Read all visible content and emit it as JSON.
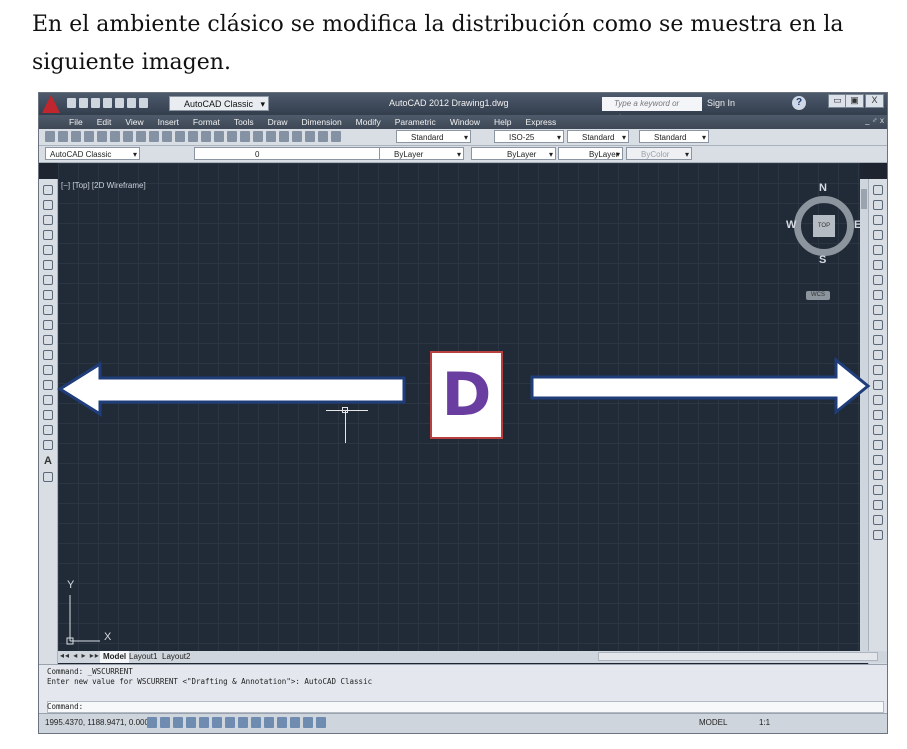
{
  "paragraph": {
    "line1": "En el ambiente clásico  se modifica la distribución como se muestra en la",
    "line2": "siguiente imagen."
  },
  "autocad": {
    "workspace_select": "AutoCAD Classic",
    "app_title": "AutoCAD 2012   Drawing1.dwg",
    "search_placeholder": "Type a keyword or phrase",
    "sign_in": "Sign In",
    "help_icon": "?",
    "window_buttons": [
      "▭",
      "▣",
      "X"
    ],
    "mdi_controls": "_ ♂ x",
    "menu": [
      "File",
      "Edit",
      "View",
      "Insert",
      "Format",
      "Tools",
      "Draw",
      "Dimension",
      "Modify",
      "Parametric",
      "Window",
      "Help",
      "Express"
    ],
    "toolbar1": {
      "text_style": "Standard",
      "dim_style": "ISO-25",
      "table_style": "Standard",
      "mleader_style": "Standard"
    },
    "toolbar2": {
      "workspace": "AutoCAD Classic",
      "layer": "0",
      "color": "ByLayer",
      "linetype": "ByLayer",
      "lineweight": "ByLayer",
      "plotstyle": "ByColor"
    },
    "viewport_label": "[−] [Top] [2D Wireframe]",
    "viewcube": {
      "north": "N",
      "south": "S",
      "east": "E",
      "west": "W",
      "face": "TOP",
      "wcs": "WCS"
    },
    "ucs": {
      "x": "X",
      "y": "Y"
    },
    "layout_nav": "◂◂ ◂ ▸ ▸▸",
    "layout_tabs": [
      "Model",
      "Layout1",
      "Layout2"
    ],
    "command_lines": [
      "Command: _WSCURRENT",
      "Enter new value for WSCURRENT <\"Drafting & Annotation\">: AutoCAD Classic",
      "Command:"
    ],
    "coords": "1995.4370, 1188.9471, 0.0000",
    "model_label": "MODEL",
    "annotation_scale": "1:1"
  },
  "overlay": {
    "logo_letter": "D"
  },
  "colors": {
    "drawing_bg": "#212a37",
    "arrow_fill": "#ffffff",
    "arrow_stroke": "#1f3d7a",
    "logo_letter": "#6a3ea1",
    "logo_border": "#b8403e"
  }
}
